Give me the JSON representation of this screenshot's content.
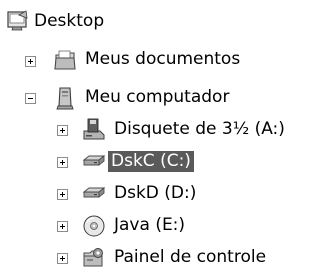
{
  "tree": {
    "root": {
      "label": "Desktop",
      "icon": "desktop-icon"
    },
    "my_documents": {
      "label": "Meus documentos",
      "icon": "folder-documents-icon",
      "expander": "plus"
    },
    "my_computer": {
      "label": "Meu computador",
      "icon": "computer-icon",
      "expander": "minus"
    },
    "floppy": {
      "label": "Disquete de 3½ (A:)",
      "icon": "floppy-drive-icon",
      "expander": "plus"
    },
    "drive_c": {
      "label": "DskC (C:)",
      "icon": "hard-drive-icon",
      "expander": "plus",
      "selected": true
    },
    "drive_d": {
      "label": "DskD (D:)",
      "icon": "hard-drive-icon",
      "expander": "plus"
    },
    "drive_e": {
      "label": "Java (E:)",
      "icon": "cd-drive-icon",
      "expander": "plus"
    },
    "control_panel": {
      "label": "Painel de controle",
      "icon": "control-panel-icon",
      "expander": "plus"
    }
  },
  "colors": {
    "selection_background": "#5a5a5a",
    "selection_text": "#ffffff",
    "expander_border": "#8c8c8c"
  }
}
